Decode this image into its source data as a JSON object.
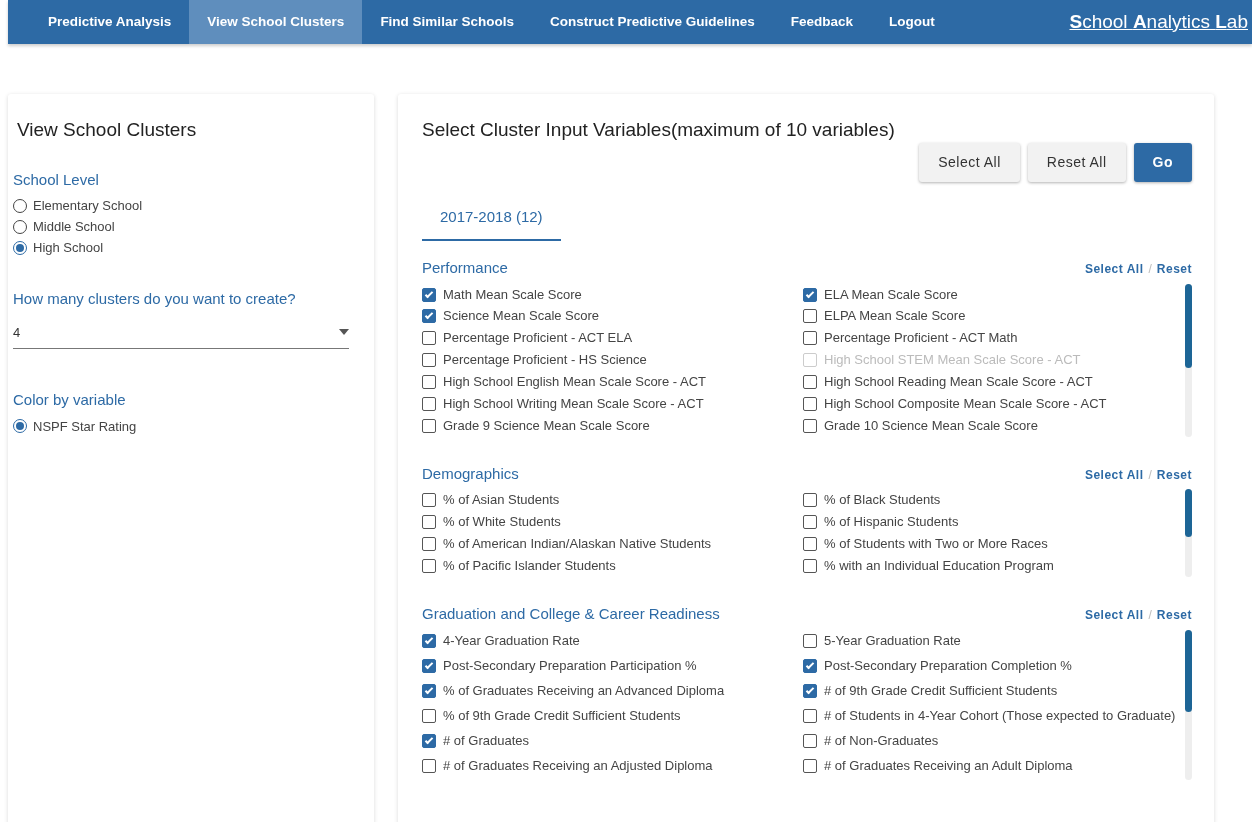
{
  "navbar": {
    "items": [
      {
        "label": "Predictive Analysis",
        "selected": false
      },
      {
        "label": "View School Clusters",
        "selected": true
      },
      {
        "label": "Find Similar Schools",
        "selected": false
      },
      {
        "label": "Construct Predictive Guidelines",
        "selected": false
      },
      {
        "label": "Feedback",
        "selected": false
      },
      {
        "label": "Logout",
        "selected": false
      }
    ],
    "brand": "**S**chool **A**nalytics **L**ab"
  },
  "sidebar": {
    "title": "View School Clusters",
    "school_level": {
      "label": "School Level",
      "options": [
        {
          "label": "Elementary School",
          "selected": false
        },
        {
          "label": "Middle School",
          "selected": false
        },
        {
          "label": "High School",
          "selected": true
        }
      ]
    },
    "clusters": {
      "label": "How many clusters do you want to create?",
      "value": "4"
    },
    "color_by": {
      "label": "Color by variable",
      "options": [
        {
          "label": "NSPF Star Rating",
          "selected": true
        }
      ]
    }
  },
  "main": {
    "title": "Select Cluster Input Variables(maximum of 10 variables)",
    "buttons": [
      {
        "label": "Select All",
        "kind": "secondary"
      },
      {
        "label": "Reset All",
        "kind": "secondary"
      },
      {
        "label": "Go",
        "kind": "primary"
      }
    ],
    "tabs": [
      {
        "label": "2017-2018 (12)",
        "selected": true
      }
    ],
    "sections": [
      {
        "title": "Performance",
        "select_all": "Select All",
        "separator": "/",
        "reset": "Reset",
        "items": [
          {
            "label": "Math Mean Scale Score",
            "checked": true,
            "disabled": false
          },
          {
            "label": "ELA Mean Scale Score",
            "checked": true,
            "disabled": false
          },
          {
            "label": "Science Mean Scale Score",
            "checked": true,
            "disabled": false
          },
          {
            "label": "ELPA Mean Scale Score",
            "checked": false,
            "disabled": false
          },
          {
            "label": "Percentage Proficient - ACT ELA",
            "checked": false,
            "disabled": false
          },
          {
            "label": "Percentage Proficient - ACT Math",
            "checked": false,
            "disabled": false
          },
          {
            "label": "Percentage Proficient - HS Science",
            "checked": false,
            "disabled": false
          },
          {
            "label": "High School STEM Mean Scale Score - ACT",
            "checked": false,
            "disabled": true
          },
          {
            "label": "High School English Mean Scale Score - ACT",
            "checked": false,
            "disabled": false
          },
          {
            "label": "High School Reading Mean Scale Score - ACT",
            "checked": false,
            "disabled": false
          },
          {
            "label": "High School Writing Mean Scale Score - ACT",
            "checked": false,
            "disabled": false
          },
          {
            "label": "High School Composite Mean Scale Score - ACT",
            "checked": false,
            "disabled": false
          },
          {
            "label": "Grade 9 Science Mean Scale Score",
            "checked": false,
            "disabled": false
          },
          {
            "label": "Grade 10 Science Mean Scale Score",
            "checked": false,
            "disabled": false
          }
        ]
      },
      {
        "title": "Demographics",
        "select_all": "Select All",
        "separator": "/",
        "reset": "Reset",
        "items": [
          {
            "label": "% of Asian Students",
            "checked": false,
            "disabled": false
          },
          {
            "label": "% of Black Students",
            "checked": false,
            "disabled": false
          },
          {
            "label": "% of White Students",
            "checked": false,
            "disabled": false
          },
          {
            "label": "% of Hispanic Students",
            "checked": false,
            "disabled": false
          },
          {
            "label": "% of American Indian/Alaskan Native Students",
            "checked": false,
            "disabled": false
          },
          {
            "label": "% of Students with Two or More Races",
            "checked": false,
            "disabled": false
          },
          {
            "label": "% of Pacific Islander Students",
            "checked": false,
            "disabled": false
          },
          {
            "label": "% with an Individual Education Program",
            "checked": false,
            "disabled": false
          }
        ]
      },
      {
        "title": "Graduation and College & Career Readiness",
        "select_all": "Select All",
        "separator": "/",
        "reset": "Reset",
        "items": [
          {
            "label": "4-Year Graduation Rate",
            "checked": true,
            "disabled": false
          },
          {
            "label": "5-Year Graduation Rate",
            "checked": false,
            "disabled": false
          },
          {
            "label": "Post-Secondary Preparation Participation %",
            "checked": true,
            "disabled": false
          },
          {
            "label": "Post-Secondary Preparation Completion %",
            "checked": true,
            "disabled": false
          },
          {
            "label": "% of Graduates Receiving an Advanced Diploma",
            "checked": true,
            "disabled": false
          },
          {
            "label": "# of 9th Grade Credit Sufficient Students",
            "checked": true,
            "disabled": false
          },
          {
            "label": "% of 9th Grade Credit Sufficient Students",
            "checked": false,
            "disabled": false
          },
          {
            "label": "# of Students in 4-Year Cohort (Those expected to Graduate)",
            "checked": false,
            "disabled": false
          },
          {
            "label": "# of Graduates",
            "checked": true,
            "disabled": false
          },
          {
            "label": "# of Non-Graduates",
            "checked": false,
            "disabled": false
          },
          {
            "label": "# of Graduates Receiving an Adjusted Diploma",
            "checked": false,
            "disabled": false
          },
          {
            "label": "# of Graduates Receiving an Adult Diploma",
            "checked": false,
            "disabled": false
          }
        ]
      }
    ]
  }
}
